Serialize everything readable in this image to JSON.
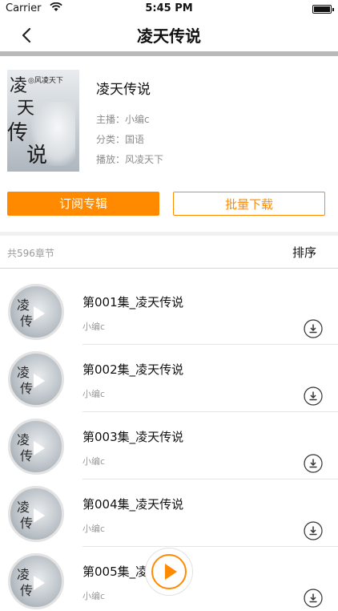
{
  "status_bar": {
    "carrier": "Carrier",
    "time": "5:45 PM"
  },
  "nav": {
    "title": "凌天传说",
    "back_icon": "chevron-left-icon"
  },
  "album": {
    "cover_text": [
      "凌",
      "天",
      "传",
      "说"
    ],
    "cover_author": "◎风凌天下",
    "title": "凌天传说",
    "host": "主播：小编c",
    "category": "分类：国语",
    "played": "播放：风凌天下"
  },
  "buttons": {
    "subscribe": "订阅专辑",
    "batch_download": "批量下载"
  },
  "list_header": {
    "count": "共596章节",
    "sort": "排序"
  },
  "episodes": [
    {
      "title": "第001集_凌天传说",
      "author": "小编c"
    },
    {
      "title": "第002集_凌天传说",
      "author": "小编c"
    },
    {
      "title": "第003集_凌天传说",
      "author": "小编c"
    },
    {
      "title": "第004集_凌天传说",
      "author": "小编c"
    },
    {
      "title": "第005集_凌天传说",
      "author": "小编c"
    }
  ],
  "colors": {
    "accent": "#ff8a00",
    "divider": "#b9b9b9"
  }
}
